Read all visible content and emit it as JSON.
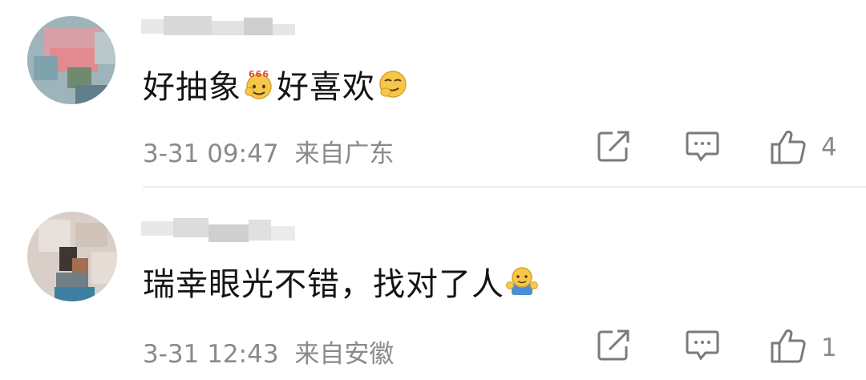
{
  "comments": [
    {
      "text_parts": [
        "好抽象",
        "好喜欢"
      ],
      "emojis": [
        "666-emoji",
        "smug-emoji"
      ],
      "time": "3-31 09:47",
      "location": "来自广东",
      "likes": "4"
    },
    {
      "text_parts": [
        "瑞幸眼光不错，找对了人"
      ],
      "emojis": [
        "hug-emoji"
      ],
      "time": "3-31 12:43",
      "location": "来自安徽",
      "likes": "1"
    }
  ],
  "icons": {
    "share": "share-icon",
    "comment": "comment-icon",
    "like": "thumbs-up-icon"
  },
  "colors": {
    "text": "#141414",
    "meta": "#8a8a8a",
    "divider": "#ececec",
    "icon": "#7a7a7a"
  }
}
